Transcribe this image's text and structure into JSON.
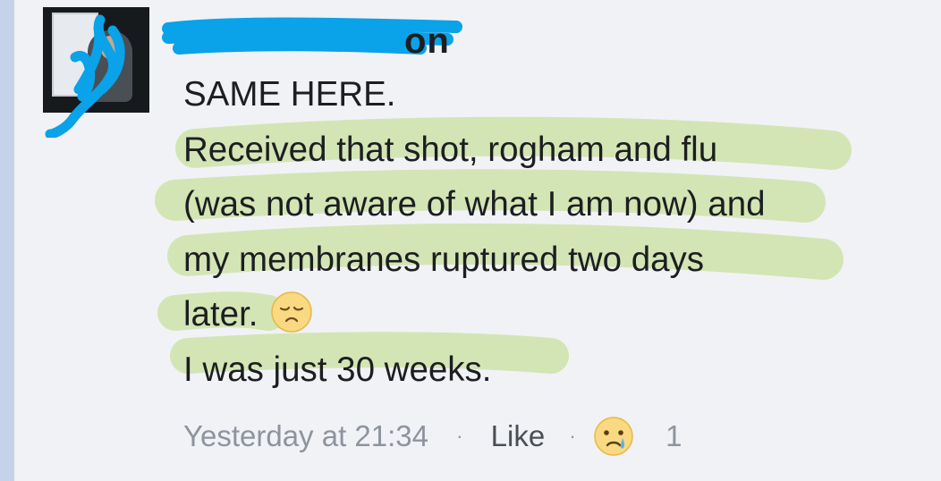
{
  "comment": {
    "author_visible_fragment": "on",
    "lines": [
      "SAME HERE.",
      "Received that shot, rogham and flu",
      "(was not aware of what I am now) and",
      "my membranes ruptured two days",
      "later.",
      "I was just 30 weeks."
    ],
    "inline_emoji": "disappointed-face-emoji"
  },
  "meta": {
    "timestamp": "Yesterday at 21:34",
    "separator": "·",
    "like_label": "Like",
    "reaction_icon": "crying-face-emoji",
    "reaction_count": "1"
  },
  "colors": {
    "highlight": "#cfe3ad",
    "scribble": "#0aa2e8",
    "left_rule": "#c5d3ea",
    "background": "#f1f2f6"
  }
}
